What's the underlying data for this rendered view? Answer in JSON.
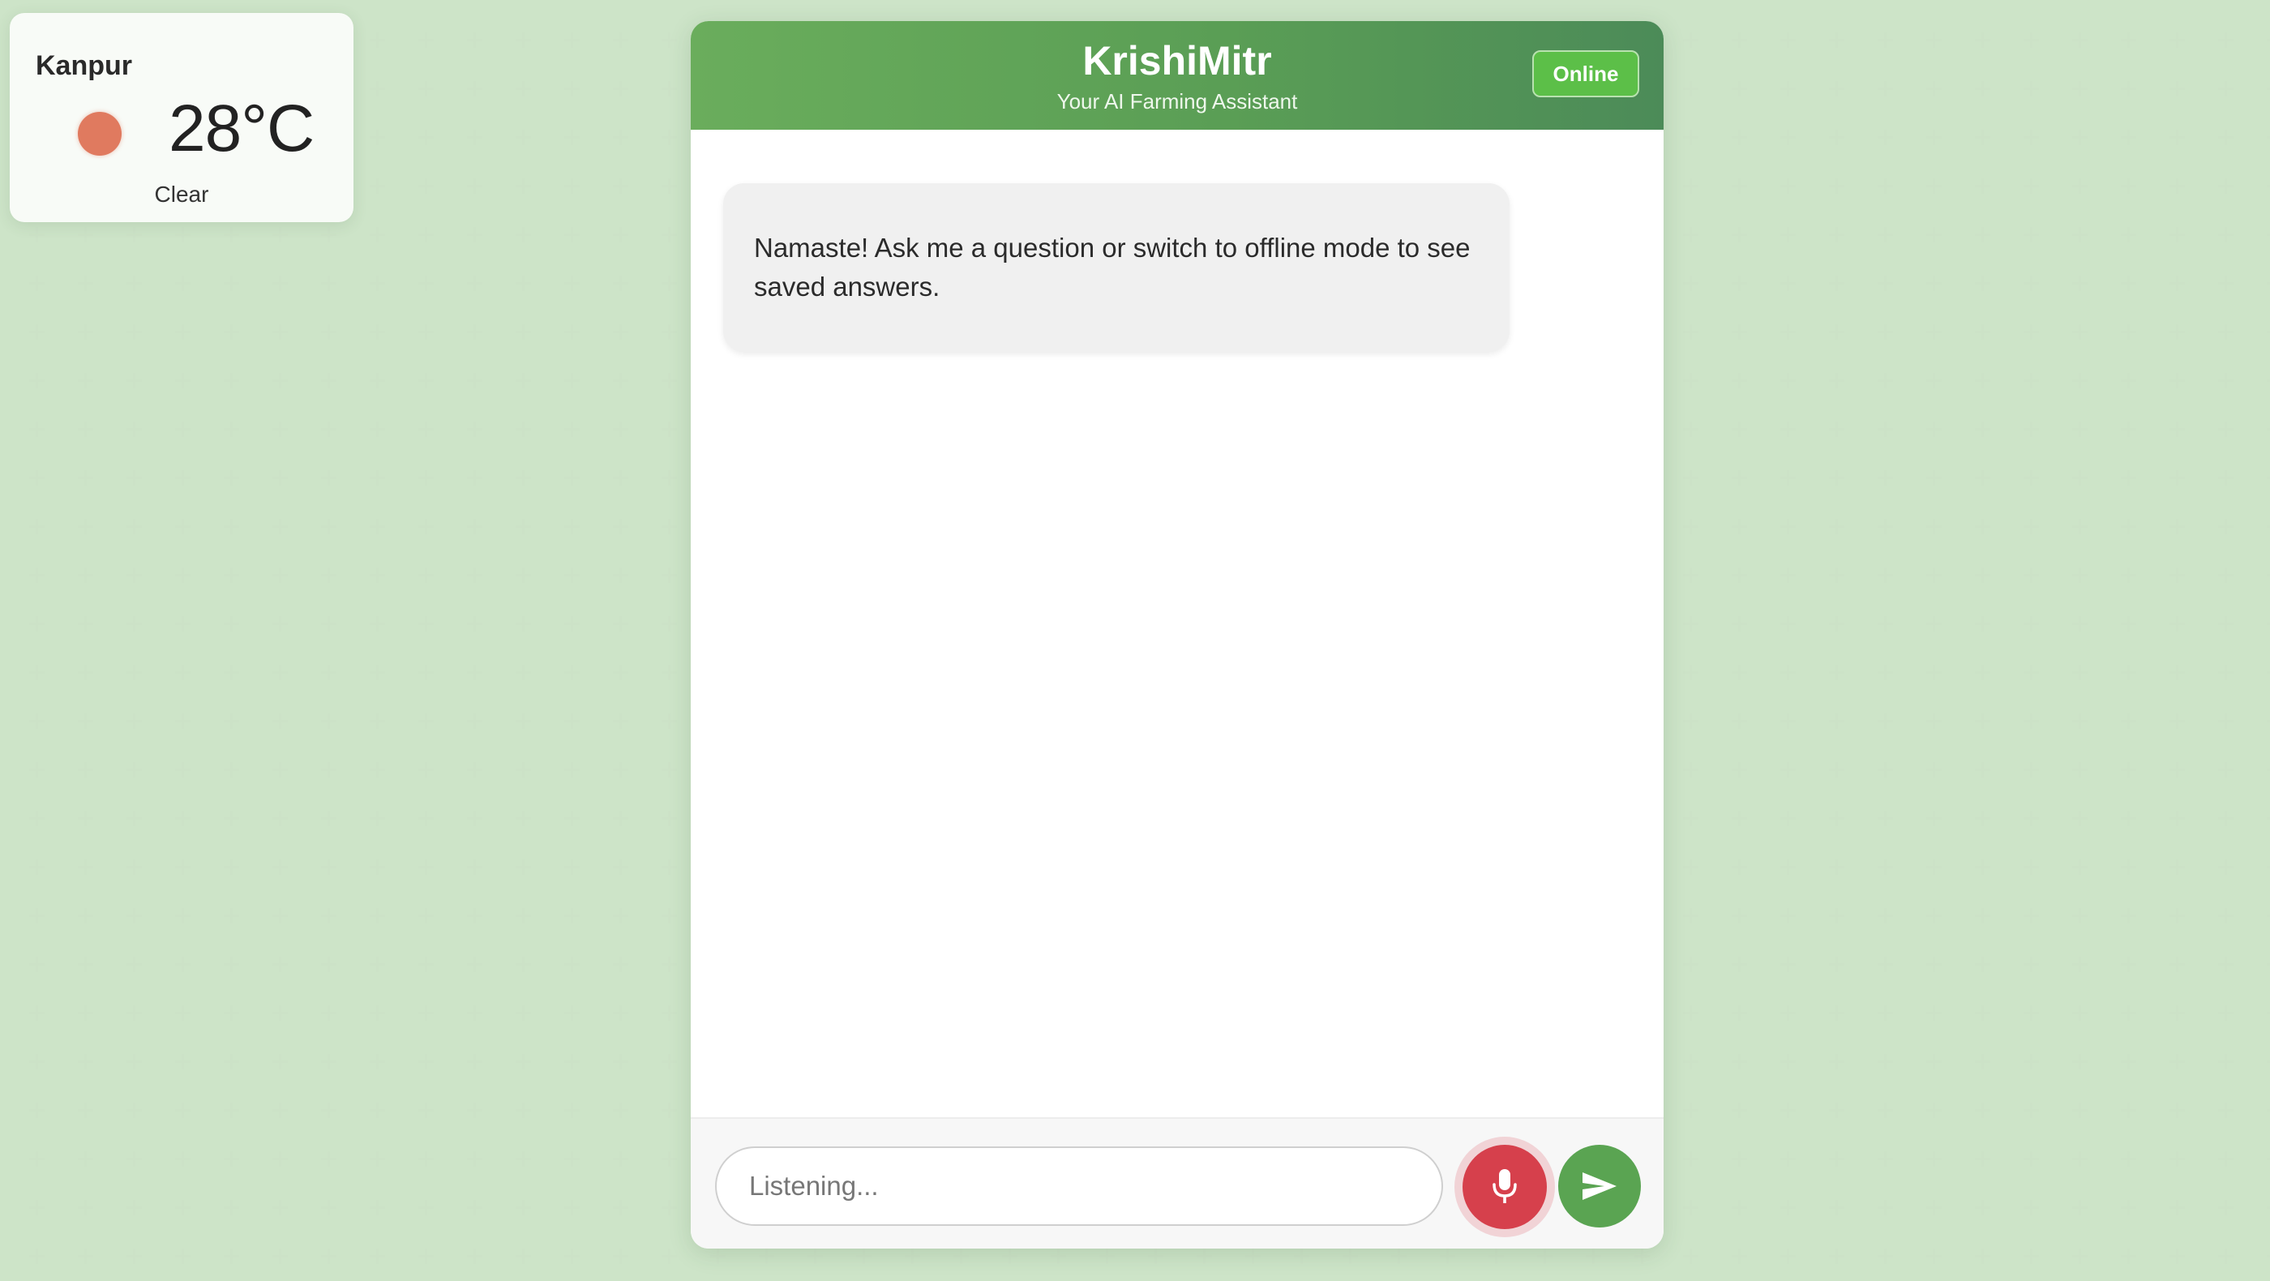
{
  "weather": {
    "city": "Kanpur",
    "temperature": "28°C",
    "condition": "Clear",
    "icon": "sun-icon",
    "icon_color": "#e07a5f"
  },
  "chat": {
    "title": "KrishiMitr",
    "subtitle": "Your AI Farming Assistant",
    "status": "Online",
    "messages": [
      {
        "sender": "bot",
        "text": "Namaste! Ask me a question or switch to offline mode to see saved answers."
      }
    ],
    "input": {
      "placeholder": "Listening...",
      "value": ""
    },
    "mic_icon": "microphone-icon",
    "send_icon": "send-icon"
  },
  "colors": {
    "header_start": "#6aad5c",
    "header_end": "#4c8b58",
    "status_badge": "#5cbf48",
    "mic_active": "#d6404c",
    "send": "#5aa452",
    "background": "#e8f3e6"
  }
}
